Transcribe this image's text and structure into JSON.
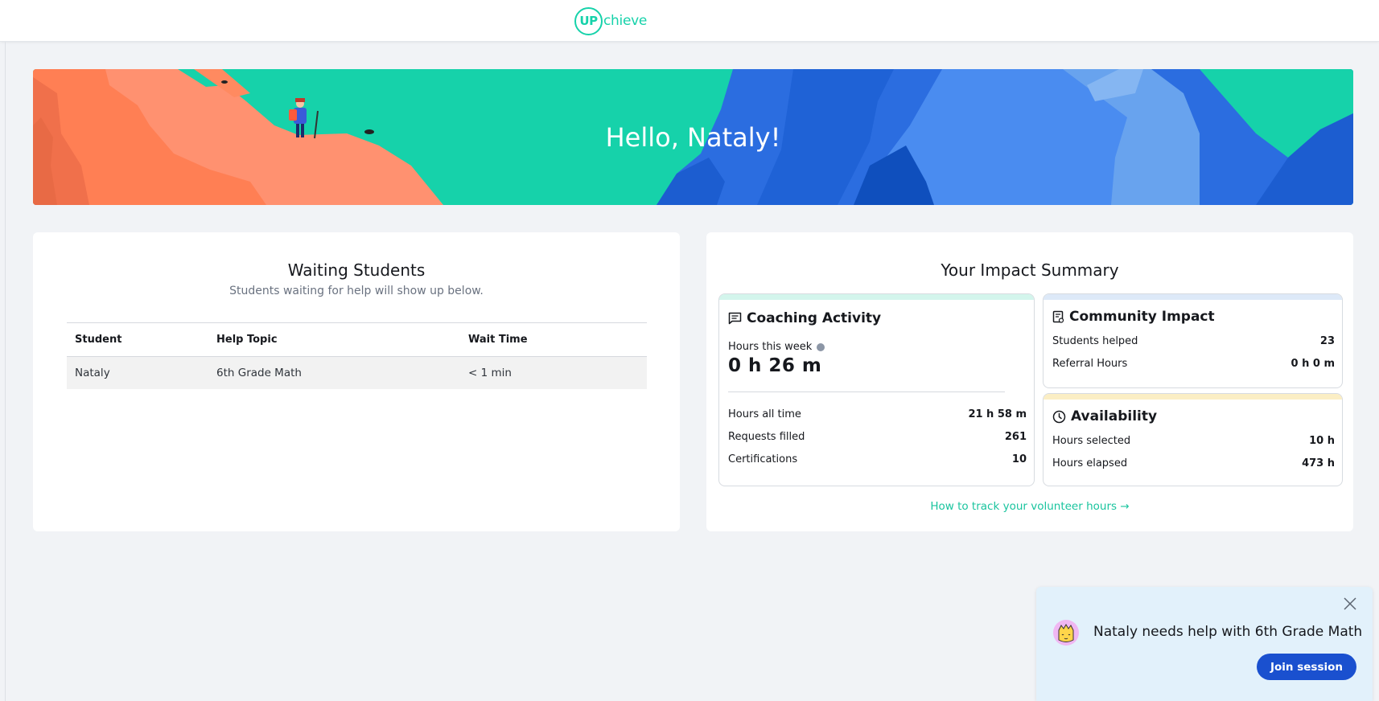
{
  "header": {
    "logo_badge": "UP",
    "logo_text": "chieve"
  },
  "banner": {
    "greeting": "Hello, Nataly!"
  },
  "waiting": {
    "title": "Waiting Students",
    "subtitle": "Students waiting for help will show up below.",
    "columns": [
      "Student",
      "Help Topic",
      "Wait Time"
    ],
    "rows": [
      {
        "student": "Nataly",
        "topic": "6th Grade Math",
        "wait": "< 1 min"
      }
    ]
  },
  "impact": {
    "title": "Your Impact Summary",
    "coaching": {
      "title": "Coaching Activity",
      "week_label": "Hours this week",
      "week_value": "0 h 26 m",
      "items": [
        {
          "label": "Hours all time",
          "value": "21 h 58 m"
        },
        {
          "label": "Requests filled",
          "value": "261"
        },
        {
          "label": "Certifications",
          "value": "10"
        }
      ],
      "accent": "#d3f5ec"
    },
    "community": {
      "title": "Community Impact",
      "items": [
        {
          "label": "Students helped",
          "value": "23"
        },
        {
          "label": "Referral Hours",
          "value": "0 h 0 m"
        }
      ],
      "accent": "#dde9f8"
    },
    "availability": {
      "title": "Availability",
      "items": [
        {
          "label": "Hours selected",
          "value": "10 h"
        },
        {
          "label": "Hours elapsed",
          "value": "473 h"
        }
      ],
      "accent": "#fbeec4"
    },
    "track_link": "How to track your volunteer hours →"
  },
  "toast": {
    "message": "Nataly needs help with 6th Grade Math",
    "button": "Join session"
  },
  "colors": {
    "brand_teal": "#16d2aa",
    "primary_blue": "#1a50cf",
    "page_bg": "#f1f3f6"
  }
}
